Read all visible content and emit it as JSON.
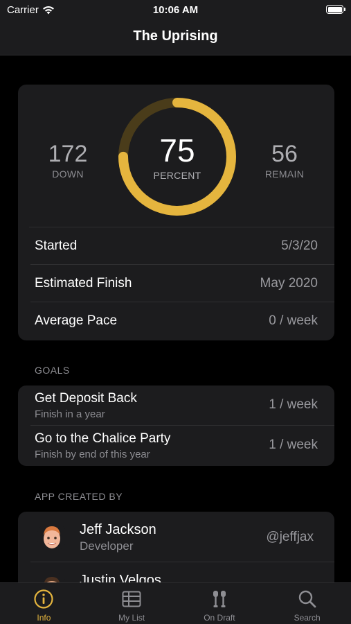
{
  "status": {
    "carrier": "Carrier",
    "time": "10:06 AM"
  },
  "nav": {
    "title": "The Uprising"
  },
  "progress": {
    "down_value": "172",
    "down_label": "DOWN",
    "percent_value": "75",
    "percent_label": "PERCENT",
    "remain_value": "56",
    "remain_label": "REMAIN",
    "percent_fraction": 0.75,
    "ring_color": "#e5b53e",
    "ring_track_color": "#4a3c1a"
  },
  "details": [
    {
      "label": "Started",
      "value": "5/3/20"
    },
    {
      "label": "Estimated Finish",
      "value": "May 2020"
    },
    {
      "label": "Average Pace",
      "value": "0 / week"
    }
  ],
  "goals_header": "GOALS",
  "goals": [
    {
      "title": "Get Deposit Back",
      "subtitle": "Finish in a year",
      "rate": "1 / week"
    },
    {
      "title": "Go to the Chalice Party",
      "subtitle": "Finish by end of this year",
      "rate": "1 / week"
    }
  ],
  "creators_header": "APP CREATED BY",
  "creators": [
    {
      "name": "Jeff Jackson",
      "role": "Developer",
      "handle": "@jeffjax",
      "avatar_icon": "memoji-avatar-icon"
    },
    {
      "name": "Justin Velgos",
      "role": "",
      "handle": "",
      "avatar_icon": "memoji-avatar-icon"
    }
  ],
  "tabs": [
    {
      "label": "Info",
      "icon": "info-icon",
      "active": true
    },
    {
      "label": "My List",
      "icon": "list-grid-icon",
      "active": false
    },
    {
      "label": "On Draft",
      "icon": "beer-taps-icon",
      "active": false
    },
    {
      "label": "Search",
      "icon": "search-icon",
      "active": false
    }
  ],
  "colors": {
    "accent": "#e5b53e",
    "background": "#000000",
    "card": "#1c1c1e"
  }
}
